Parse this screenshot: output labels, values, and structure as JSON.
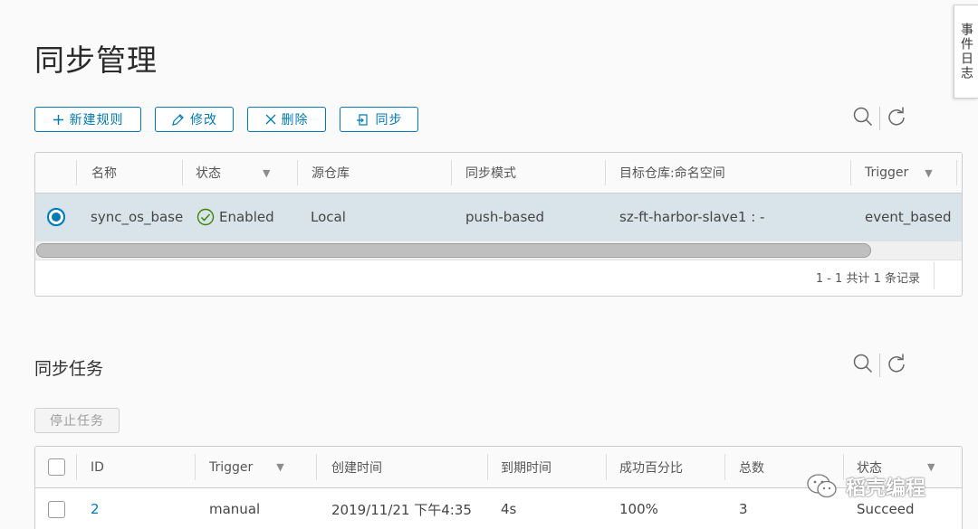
{
  "page": {
    "title": "同步管理"
  },
  "side_tab": {
    "label": "事件日志"
  },
  "toolbar": {
    "new_rule": "新建规则",
    "edit": "修改",
    "delete": "删除",
    "sync": "同步"
  },
  "rules_grid": {
    "columns": [
      "名称",
      "状态",
      "源仓库",
      "同步模式",
      "目标仓库:命名空间",
      "Trigger"
    ],
    "rows": [
      {
        "selected": true,
        "name": "sync_os_base",
        "status": "Enabled",
        "source": "Local",
        "mode": "push-based",
        "target": "sz-ft-harbor-slave1 : -",
        "trigger": "event_based"
      }
    ],
    "footer": "1 - 1 共计 1 条记录"
  },
  "tasks": {
    "title": "同步任务",
    "stop_button": "停止任务",
    "columns": [
      "ID",
      "Trigger",
      "创建时间",
      "到期时间",
      "成功百分比",
      "总数",
      "状态"
    ],
    "rows": [
      {
        "id": "2",
        "trigger": "manual",
        "created": "2019/11/21 下午4:35",
        "duration": "4s",
        "percent": "100%",
        "total": "3",
        "status": "Succeed"
      }
    ]
  },
  "watermark": {
    "text": "稻壳编程"
  },
  "colors": {
    "accent": "#0079b8",
    "selected_row": "#d9e4ea",
    "success": "#3c8500"
  },
  "icons": [
    "plus-icon",
    "pencil-icon",
    "close-icon",
    "sync-icon",
    "search-icon",
    "refresh-icon",
    "filter-icon",
    "check-circle-icon",
    "wechat-icon"
  ]
}
